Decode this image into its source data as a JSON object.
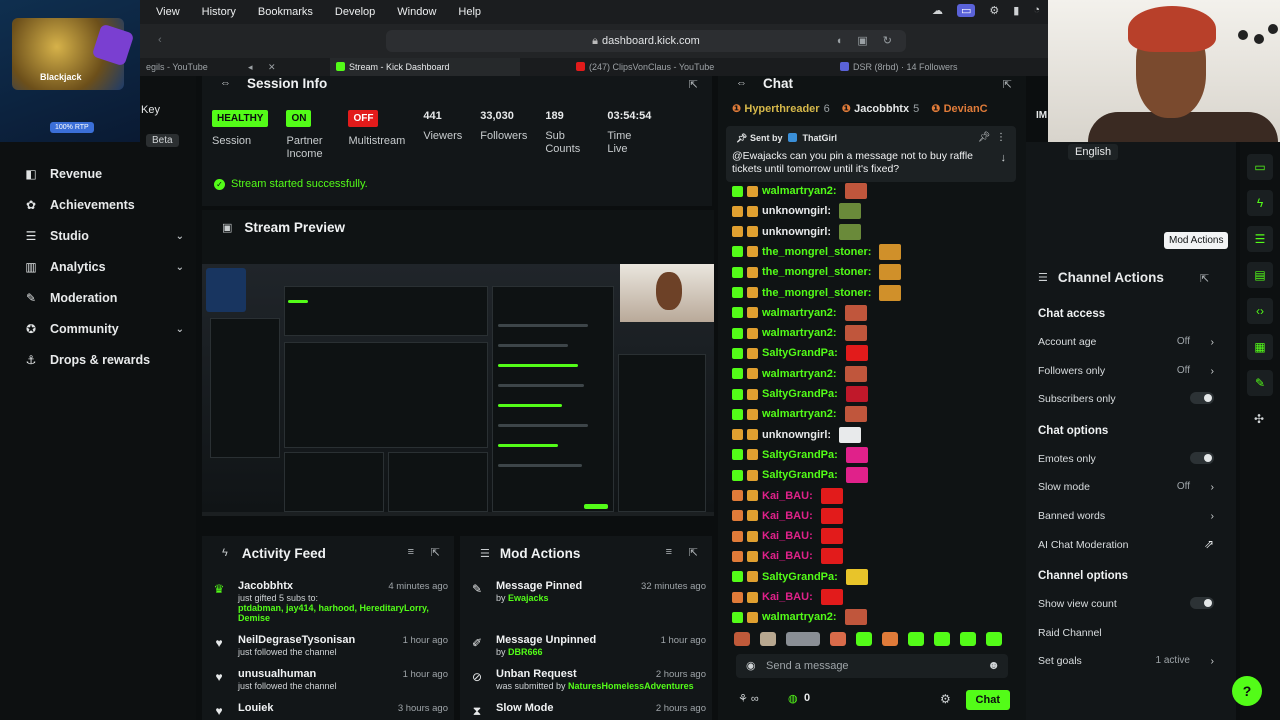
{
  "menubar": {
    "items": [
      "View",
      "History",
      "Bookmarks",
      "Develop",
      "Window",
      "Help"
    ]
  },
  "browser": {
    "url": "dashboard.kick.com",
    "tabs": [
      {
        "label": "egils - YouTube",
        "active": false
      },
      {
        "label": "Stream - Kick Dashboard",
        "active": true
      },
      {
        "label": "(247) ClipsVonClaus - YouTube",
        "active": false
      },
      {
        "label": "DSR (8rbd) · 14 Followers",
        "active": false
      }
    ]
  },
  "overlay": {
    "game_name": "Blackjack",
    "rtp": "100% RTP"
  },
  "leftnav": {
    "partial_key": "Key",
    "beta": "Beta",
    "items": [
      {
        "label": "Revenue",
        "chevron": false
      },
      {
        "label": "Achievements",
        "chevron": false
      },
      {
        "label": "Studio",
        "chevron": true
      },
      {
        "label": "Analytics",
        "chevron": true
      },
      {
        "label": "Moderation",
        "chevron": false
      },
      {
        "label": "Community",
        "chevron": true
      },
      {
        "label": "Drops & rewards",
        "chevron": false
      }
    ]
  },
  "session": {
    "title": "Session Info",
    "stats": [
      {
        "badge": "HEALTHY",
        "badge_color": "#53fc18",
        "label": "Session"
      },
      {
        "badge": "ON",
        "badge_color": "#53fc18",
        "label": "Partner Income"
      },
      {
        "badge": "OFF",
        "badge_color": "#e21b1b",
        "label": "Multistream"
      },
      {
        "value": "441",
        "label": "Viewers"
      },
      {
        "value": "33,030",
        "label": "Followers"
      },
      {
        "value": "189",
        "label": "Sub Counts"
      },
      {
        "value": "03:54:54",
        "label": "Time Live"
      }
    ],
    "success": "Stream started successfully."
  },
  "preview": {
    "title": "Stream Preview"
  },
  "activity": {
    "title": "Activity Feed",
    "items": [
      {
        "name": "Jacobbhtx",
        "time": "4 minutes ago",
        "desc": "just gifted 5 subs to:",
        "highlight": "ptdabman, jay414, harhood, HereditaryLorry, Demise"
      },
      {
        "name": "NeilDegraseTysonisan",
        "time": "1 hour ago",
        "desc": "just followed the channel",
        "highlight": ""
      },
      {
        "name": "unusualhuman",
        "time": "1 hour ago",
        "desc": "just followed the channel",
        "highlight": ""
      },
      {
        "name": "Louiek",
        "time": "3 hours ago",
        "desc": "",
        "highlight": ""
      }
    ]
  },
  "mod": {
    "title": "Mod Actions",
    "items": [
      {
        "name": "Message Pinned",
        "time": "32 minutes ago",
        "desc": "by",
        "highlight": "Ewajacks"
      },
      {
        "name": "Message Unpinned",
        "time": "1 hour ago",
        "desc": "by",
        "highlight": "DBR666"
      },
      {
        "name": "Unban Request",
        "time": "2 hours ago",
        "desc": "was submitted by",
        "highlight": "NaturesHomelessAdventures"
      },
      {
        "name": "Slow Mode",
        "time": "2 hours ago",
        "desc": "",
        "highlight": ""
      }
    ]
  },
  "chat": {
    "title": "Chat",
    "leaders": [
      {
        "name": "Hyperthreader",
        "count": "6",
        "color": "#d6b84a"
      },
      {
        "name": "Jacobbhtx",
        "count": "5",
        "color": "#e4e6e7"
      },
      {
        "name": "DevianC",
        "count": "",
        "color": "#e07b39"
      }
    ],
    "pinned_by": "Sent by",
    "pinned_user": "ThatGirl",
    "pinned_msg": "@Ewajacks can you pin a message not to buy raffle tickets until tomorrow until it's fixed?",
    "messages": [
      {
        "user": "walmartryan2:",
        "color": "#53fc18"
      },
      {
        "user": "unknowngirl:",
        "color": "#e8eaeb"
      },
      {
        "user": "unknowngirl:",
        "color": "#e8eaeb"
      },
      {
        "user": "the_mongrel_stoner:",
        "color": "#53fc18"
      },
      {
        "user": "the_mongrel_stoner:",
        "color": "#53fc18"
      },
      {
        "user": "the_mongrel_stoner:",
        "color": "#53fc18"
      },
      {
        "user": "walmartryan2:",
        "color": "#53fc18"
      },
      {
        "user": "walmartryan2:",
        "color": "#53fc18"
      },
      {
        "user": "SaltyGrandPa:",
        "color": "#53fc18"
      },
      {
        "user": "walmartryan2:",
        "color": "#53fc18"
      },
      {
        "user": "SaltyGrandPa:",
        "color": "#53fc18"
      },
      {
        "user": "walmartryan2:",
        "color": "#53fc18"
      },
      {
        "user": "unknowngirl:",
        "color": "#e8eaeb"
      },
      {
        "user": "SaltyGrandPa:",
        "color": "#53fc18"
      },
      {
        "user": "SaltyGrandPa:",
        "color": "#53fc18"
      },
      {
        "user": "Kai_BAU:",
        "color": "#e0218a"
      },
      {
        "user": "Kai_BAU:",
        "color": "#e0218a"
      },
      {
        "user": "Kai_BAU:",
        "color": "#e0218a"
      },
      {
        "user": "Kai_BAU:",
        "color": "#e0218a"
      },
      {
        "user": "SaltyGrandPa:",
        "color": "#53fc18"
      },
      {
        "user": "Kai_BAU:",
        "color": "#e0218a"
      },
      {
        "user": "walmartryan2:",
        "color": "#53fc18"
      }
    ],
    "placeholder": "Send a message",
    "viewers_count": "0",
    "send_label": "Chat"
  },
  "right": {
    "im_label": "IM",
    "language": "English",
    "tooltip": "Mod Actions",
    "title": "Channel Actions",
    "sections": [
      {
        "title": "Chat access",
        "options": [
          {
            "label": "Account age",
            "value": "Off",
            "kind": "chevron"
          },
          {
            "label": "Followers only",
            "value": "Off",
            "kind": "chevron"
          },
          {
            "label": "Subscribers only",
            "value": "",
            "kind": "toggle"
          }
        ]
      },
      {
        "title": "Chat options",
        "options": [
          {
            "label": "Emotes only",
            "value": "",
            "kind": "toggle"
          },
          {
            "label": "Slow mode",
            "value": "Off",
            "kind": "chevron"
          },
          {
            "label": "Banned words",
            "value": "",
            "kind": "chevron"
          },
          {
            "label": "AI Chat Moderation",
            "value": "",
            "kind": "external"
          }
        ]
      },
      {
        "title": "Channel options",
        "options": [
          {
            "label": "Show view count",
            "value": "",
            "kind": "toggle"
          },
          {
            "label": "Raid Channel",
            "value": "",
            "kind": "none"
          },
          {
            "label": "Set goals",
            "value": "1 active",
            "kind": "chevron"
          }
        ]
      }
    ]
  },
  "colors": {
    "accent": "#53fc18",
    "danger": "#e21b1b",
    "bg": "#0b0e0f",
    "panel": "#121618"
  }
}
